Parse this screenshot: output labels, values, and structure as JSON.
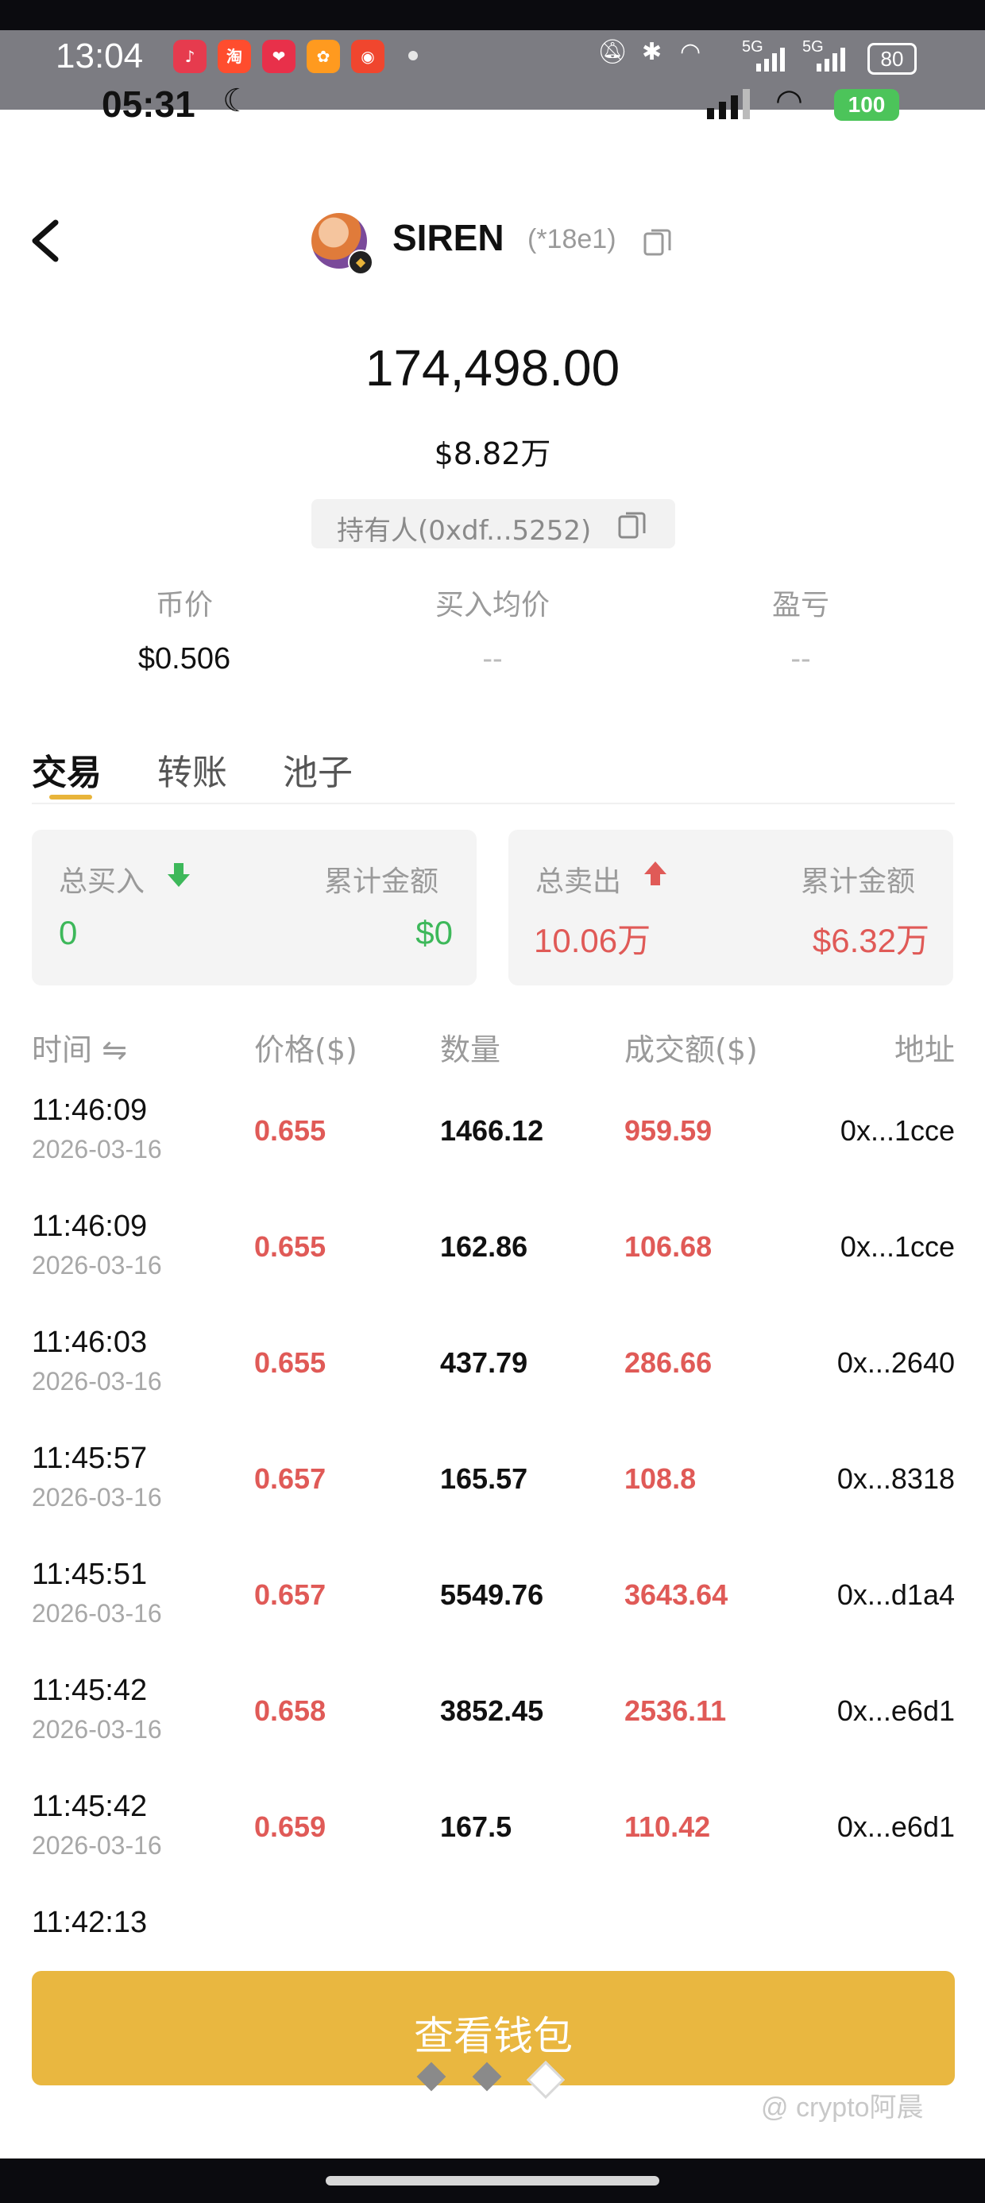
{
  "overlay_status": {
    "time": "13:04",
    "battery": "80",
    "net_a": "5G",
    "net_b": "5G",
    "app_icons": [
      {
        "name": "music-app-icon",
        "color": "#e63b4e",
        "glyph": "♪"
      },
      {
        "name": "taobao-app-icon",
        "color": "#ff4d2e",
        "glyph": "淘"
      },
      {
        "name": "heart-app-icon",
        "color": "#e8304a",
        "glyph": "❤"
      },
      {
        "name": "orange-app-icon",
        "color": "#ff9a1f",
        "glyph": "✿"
      },
      {
        "name": "red-bag-app-icon",
        "color": "#f0462e",
        "glyph": "◉"
      }
    ]
  },
  "phone_status": {
    "time": "05:31",
    "battery": "100"
  },
  "header": {
    "token_name": "SIREN",
    "token_addr": "(*18e1)"
  },
  "holding": {
    "amount": "174,498.00",
    "usd": "$8.82万",
    "holder": "持有人(0xdf...5252)"
  },
  "stats": [
    {
      "label": "币价",
      "value": "$0.506"
    },
    {
      "label": "买入均价",
      "value": "--"
    },
    {
      "label": "盈亏",
      "value": "--"
    }
  ],
  "tabs": [
    "交易",
    "转账",
    "池子"
  ],
  "summary": {
    "buy_label": "总买入",
    "buy_cum_label": "累计金额",
    "buy_value": "0",
    "buy_amount": "$0",
    "sell_label": "总卖出",
    "sell_cum_label": "累计金额",
    "sell_value": "10.06万",
    "sell_amount": "$6.32万"
  },
  "table": {
    "headers": [
      "时间 ⇋",
      "价格($)",
      "数量",
      "成交额($)",
      "地址"
    ],
    "rows": [
      {
        "time": "11:46:09",
        "date": "2026-03-16",
        "price": "0.655",
        "qty": "1466.12",
        "amount": "959.59",
        "addr": "0x...1cce"
      },
      {
        "time": "11:46:09",
        "date": "2026-03-16",
        "price": "0.655",
        "qty": "162.86",
        "amount": "106.68",
        "addr": "0x...1cce"
      },
      {
        "time": "11:46:03",
        "date": "2026-03-16",
        "price": "0.655",
        "qty": "437.79",
        "amount": "286.66",
        "addr": "0x...2640"
      },
      {
        "time": "11:45:57",
        "date": "2026-03-16",
        "price": "0.657",
        "qty": "165.57",
        "amount": "108.8",
        "addr": "0x...8318"
      },
      {
        "time": "11:45:51",
        "date": "2026-03-16",
        "price": "0.657",
        "qty": "5549.76",
        "amount": "3643.64",
        "addr": "0x...d1a4"
      },
      {
        "time": "11:45:42",
        "date": "2026-03-16",
        "price": "0.658",
        "qty": "3852.45",
        "amount": "2536.11",
        "addr": "0x...e6d1"
      },
      {
        "time": "11:45:42",
        "date": "2026-03-16",
        "price": "0.659",
        "qty": "167.5",
        "amount": "110.42",
        "addr": "0x...e6d1"
      },
      {
        "time": "11:42:13",
        "date": "",
        "price": "",
        "qty": "",
        "amount": "",
        "addr": ""
      }
    ]
  },
  "actions": {
    "view_wallet": "查看钱包"
  },
  "watermark": "@ crypto阿晨",
  "colors": {
    "accent": "#e9b740",
    "buy": "#3db85a",
    "sell": "#e05a57"
  }
}
